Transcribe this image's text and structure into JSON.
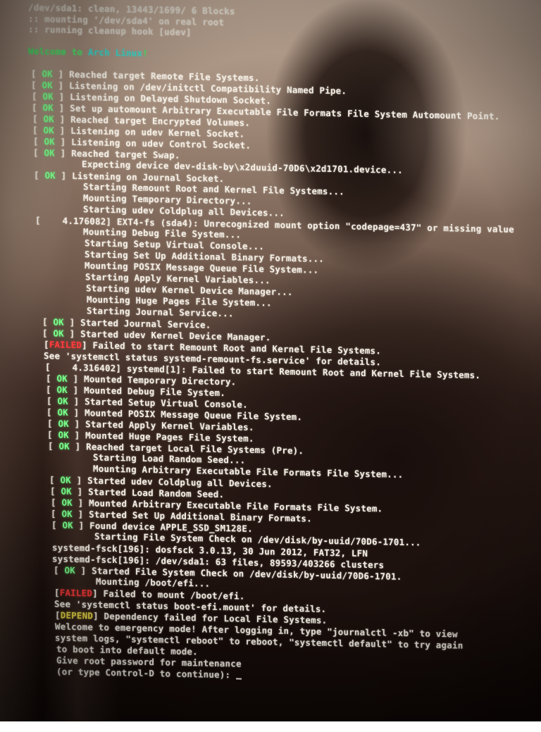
{
  "console": {
    "lines": [
      {
        "status": "",
        "text": "/dev/sda1: clean, 13443/1699/ 6 Blocks"
      },
      {
        "status": "",
        "text": ":: mounting '/dev/sda4' on real root"
      },
      {
        "status": "",
        "text": ":: running cleanup hook [udev]"
      },
      {
        "status": "",
        "text": ""
      },
      {
        "status": "",
        "text": "Welcome to ",
        "highlight": "Arch Linux",
        "suffix": "!"
      },
      {
        "status": "",
        "text": ""
      },
      {
        "status": "OK",
        "text": "Reached target Remote File Systems."
      },
      {
        "status": "OK",
        "text": "Listening on /dev/initctl Compatibility Named Pipe."
      },
      {
        "status": "OK",
        "text": "Listening on Delayed Shutdown Socket."
      },
      {
        "status": "OK",
        "text": "Set up automount Arbitrary Executable File Formats File System Automount Point."
      },
      {
        "status": "OK",
        "text": "Reached target Encrypted Volumes."
      },
      {
        "status": "OK",
        "text": "Listening on udev Kernel Socket."
      },
      {
        "status": "OK",
        "text": "Listening on udev Control Socket."
      },
      {
        "status": "OK",
        "text": "Reached target Swap."
      },
      {
        "status": "",
        "text": "Expecting device dev-disk-by\\x2duuid-70D6\\x2d1701.device..."
      },
      {
        "status": "OK",
        "text": "Listening on Journal Socket."
      },
      {
        "status": "",
        "text": "Starting Remount Root and Kernel File Systems..."
      },
      {
        "status": "",
        "text": "Mounting Temporary Directory..."
      },
      {
        "status": "",
        "text": "Starting udev Coldplug all Devices..."
      },
      {
        "status": "",
        "text": "[    4.176082] EXT4-fs (sda4): Unrecognized mount option \"codepage=437\" or missing value"
      },
      {
        "status": "",
        "text": "Mounting Debug File System..."
      },
      {
        "status": "",
        "text": "Starting Setup Virtual Console..."
      },
      {
        "status": "",
        "text": "Starting Set Up Additional Binary Formats..."
      },
      {
        "status": "",
        "text": "Mounting POSIX Message Queue File System..."
      },
      {
        "status": "",
        "text": "Starting Apply Kernel Variables..."
      },
      {
        "status": "",
        "text": "Starting udev Kernel Device Manager..."
      },
      {
        "status": "",
        "text": "Mounting Huge Pages File System..."
      },
      {
        "status": "",
        "text": "Starting Journal Service..."
      },
      {
        "status": "OK",
        "text": "Started Journal Service."
      },
      {
        "status": "OK",
        "text": "Started udev Kernel Device Manager."
      },
      {
        "status": "FAILED",
        "text": "Failed to start Remount Root and Kernel File Systems."
      },
      {
        "status": "",
        "text": "See 'systemctl status systemd-remount-fs.service' for details."
      },
      {
        "status": "",
        "text": "[    4.316402] systemd[1]: Failed to start Remount Root and Kernel File Systems."
      },
      {
        "status": "OK",
        "text": "Mounted Temporary Directory."
      },
      {
        "status": "OK",
        "text": "Mounted Debug File System."
      },
      {
        "status": "OK",
        "text": "Started Setup Virtual Console."
      },
      {
        "status": "OK",
        "text": "Mounted POSIX Message Queue File System."
      },
      {
        "status": "OK",
        "text": "Started Apply Kernel Variables."
      },
      {
        "status": "OK",
        "text": "Mounted Huge Pages File System."
      },
      {
        "status": "OK",
        "text": "Reached target Local File Systems (Pre)."
      },
      {
        "status": "",
        "text": "Starting Load Random Seed..."
      },
      {
        "status": "",
        "text": "Mounting Arbitrary Executable File Formats File System..."
      },
      {
        "status": "OK",
        "text": "Started udev Coldplug all Devices."
      },
      {
        "status": "OK",
        "text": "Started Load Random Seed."
      },
      {
        "status": "OK",
        "text": "Mounted Arbitrary Executable File Formats File System."
      },
      {
        "status": "OK",
        "text": "Started Set Up Additional Binary Formats."
      },
      {
        "status": "OK",
        "text": "Found device APPLE_SSD_SM128E."
      },
      {
        "status": "",
        "text": "Starting File System Check on /dev/disk/by-uuid/70D6-1701..."
      },
      {
        "status": "",
        "text": "systemd-fsck[196]: dosfsck 3.0.13, 30 Jun 2012, FAT32, LFN"
      },
      {
        "status": "",
        "text": "systemd-fsck[196]: /dev/sda1: 63 files, 89593/403266 clusters"
      },
      {
        "status": "OK",
        "text": "Started File System Check on /dev/disk/by-uuid/70D6-1701."
      },
      {
        "status": "",
        "text": "Mounting /boot/efi..."
      },
      {
        "status": "FAILED",
        "text": "Failed to mount /boot/efi."
      },
      {
        "status": "",
        "text": "See 'systemctl status boot-efi.mount' for details."
      },
      {
        "status": "DEPEND",
        "text": "Dependency failed for Local File Systems."
      },
      {
        "status": "",
        "text": "Welcome to emergency mode! After logging in, type \"journalctl -xb\" to view"
      },
      {
        "status": "",
        "text": "system logs, \"systemctl reboot\" to reboot, \"systemctl default\" to try again"
      },
      {
        "status": "",
        "text": "to boot into default mode."
      },
      {
        "status": "",
        "text": "Give root password for maintenance"
      },
      {
        "status": "",
        "text": "(or type Control-D to continue): "
      }
    ]
  },
  "colors": {
    "ok": "#4fe36a",
    "failed": "#ff3b3b",
    "depend": "#f3e24a",
    "text": "#f4efe6",
    "arch": "#3fd7c8"
  }
}
